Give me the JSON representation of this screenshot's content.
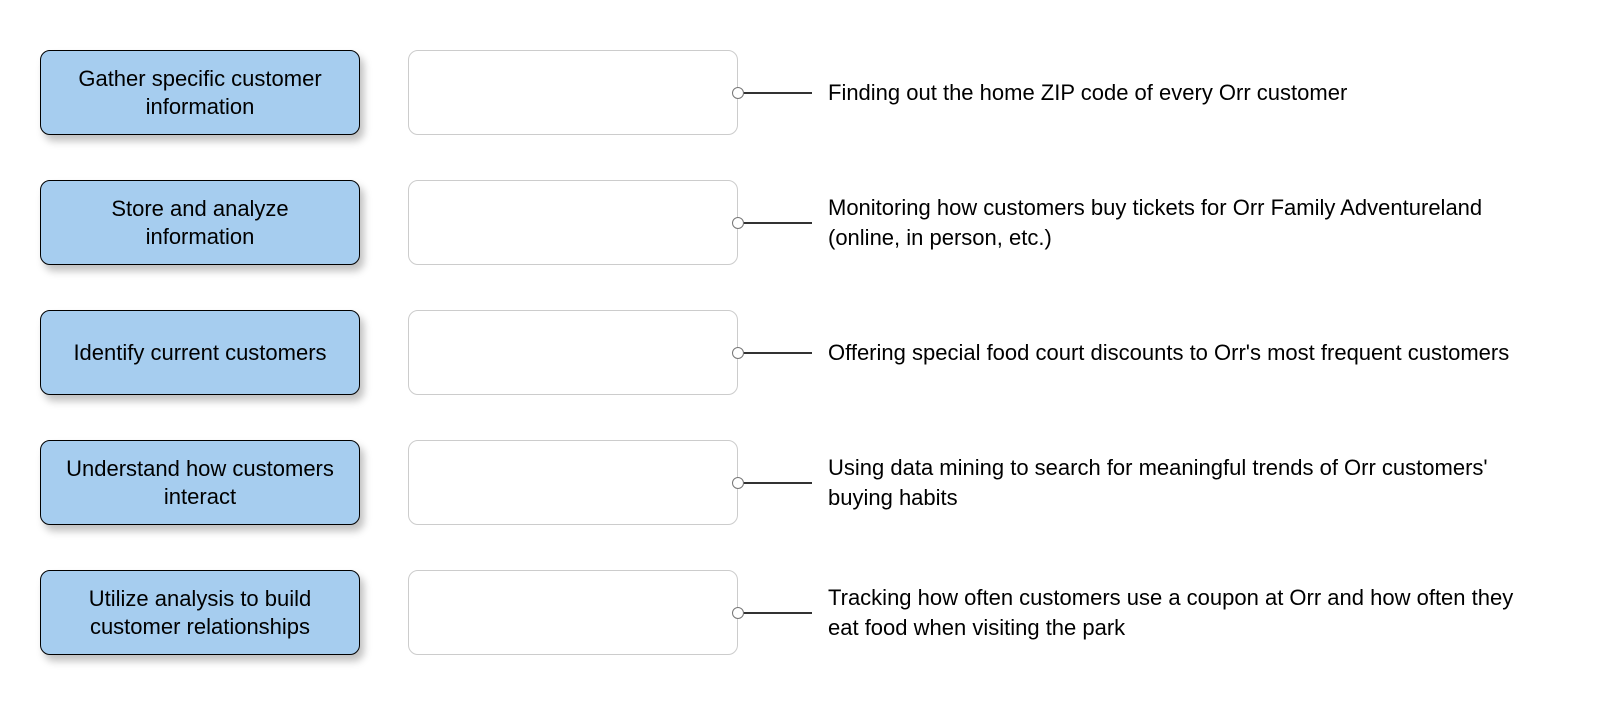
{
  "rows": [
    {
      "label": "Gather specific customer information",
      "description": "Finding out the home ZIP code of every Orr customer",
      "single": true
    },
    {
      "label": "Store and analyze information",
      "description": "Monitoring how customers buy tickets for Orr Family Adventureland (online, in person, etc.)",
      "single": false
    },
    {
      "label": "Identify current customers",
      "description": "Offering special food court discounts to Orr's most frequent customers",
      "single": false
    },
    {
      "label": "Understand how customers interact",
      "description": "Using data mining to search for meaningful trends of Orr customers' buying habits",
      "single": false
    },
    {
      "label": "Utilize analysis to build customer relationships",
      "description": "Tracking how often customers use a coupon at Orr and how often they eat food when visiting the park",
      "single": false
    }
  ],
  "layout": {
    "row_tops": [
      50,
      180,
      310,
      440,
      570
    ]
  }
}
